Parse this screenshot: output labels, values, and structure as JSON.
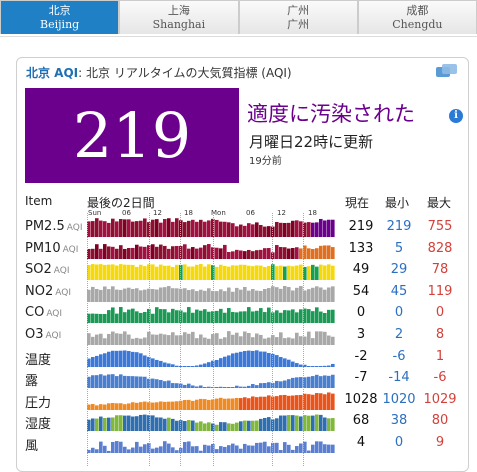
{
  "tabs": [
    {
      "zh": "北京",
      "en": "Beijing",
      "active": true
    },
    {
      "zh": "上海",
      "en": "Shanghai",
      "active": false
    },
    {
      "zh": "广州",
      "en": "广州",
      "active": false
    },
    {
      "zh": "成都",
      "en": "Chengdu",
      "active": false
    }
  ],
  "header": {
    "city": "北京 AQI",
    "text": ": 北京 リアルタイムの大気質指標 (AQI)"
  },
  "aqi": {
    "value": "219",
    "status": "適度に汚染された",
    "updated": "月曜日22時に更新",
    "ago": "19分前",
    "color": "#6b008d"
  },
  "table": {
    "col_item": "Item",
    "col_chart": "最後の2日間",
    "col_cur": "現在",
    "col_min": "最小",
    "col_max": "最大",
    "day_ticks": [
      "Sun",
      "06",
      "12",
      "18",
      "Mon",
      "06",
      "12",
      "18"
    ],
    "rows": [
      {
        "label": "PM2.5",
        "aqi": "AQI",
        "cur": "219",
        "min": "219",
        "max": "755",
        "kind": "aqi"
      },
      {
        "label": "PM10",
        "aqi": "AQI",
        "cur": "133",
        "min": "5",
        "max": "828",
        "kind": "aqi"
      },
      {
        "label": "SO2",
        "aqi": "AQI",
        "cur": "49",
        "min": "29",
        "max": "78",
        "kind": "so2"
      },
      {
        "label": "NO2",
        "aqi": "AQI",
        "cur": "54",
        "min": "45",
        "max": "119",
        "kind": "gray"
      },
      {
        "label": "CO",
        "aqi": "AQI",
        "cur": "0",
        "min": "0",
        "max": "0",
        "kind": "green"
      },
      {
        "label": "O3",
        "aqi": "AQI",
        "cur": "3",
        "min": "2",
        "max": "8",
        "kind": "gray"
      },
      {
        "label": "温度",
        "aqi": "",
        "cur": "-2",
        "min": "-6",
        "max": "1",
        "kind": "temp"
      },
      {
        "label": "露",
        "aqi": "",
        "cur": "-7",
        "min": "-14",
        "max": "-6",
        "kind": "dew"
      },
      {
        "label": "圧力",
        "aqi": "",
        "cur": "1028",
        "min": "1020",
        "max": "1029",
        "kind": "press"
      },
      {
        "label": "湿度",
        "aqi": "",
        "cur": "68",
        "min": "38",
        "max": "80",
        "kind": "hum"
      },
      {
        "label": "風",
        "aqi": "",
        "cur": "4",
        "min": "0",
        "max": "9",
        "kind": "wind"
      }
    ]
  },
  "colors": {
    "tab_active": "#1f80c6",
    "min": "#2a6fc0",
    "max": "#d4413a",
    "accent": "#1e6fb3"
  }
}
